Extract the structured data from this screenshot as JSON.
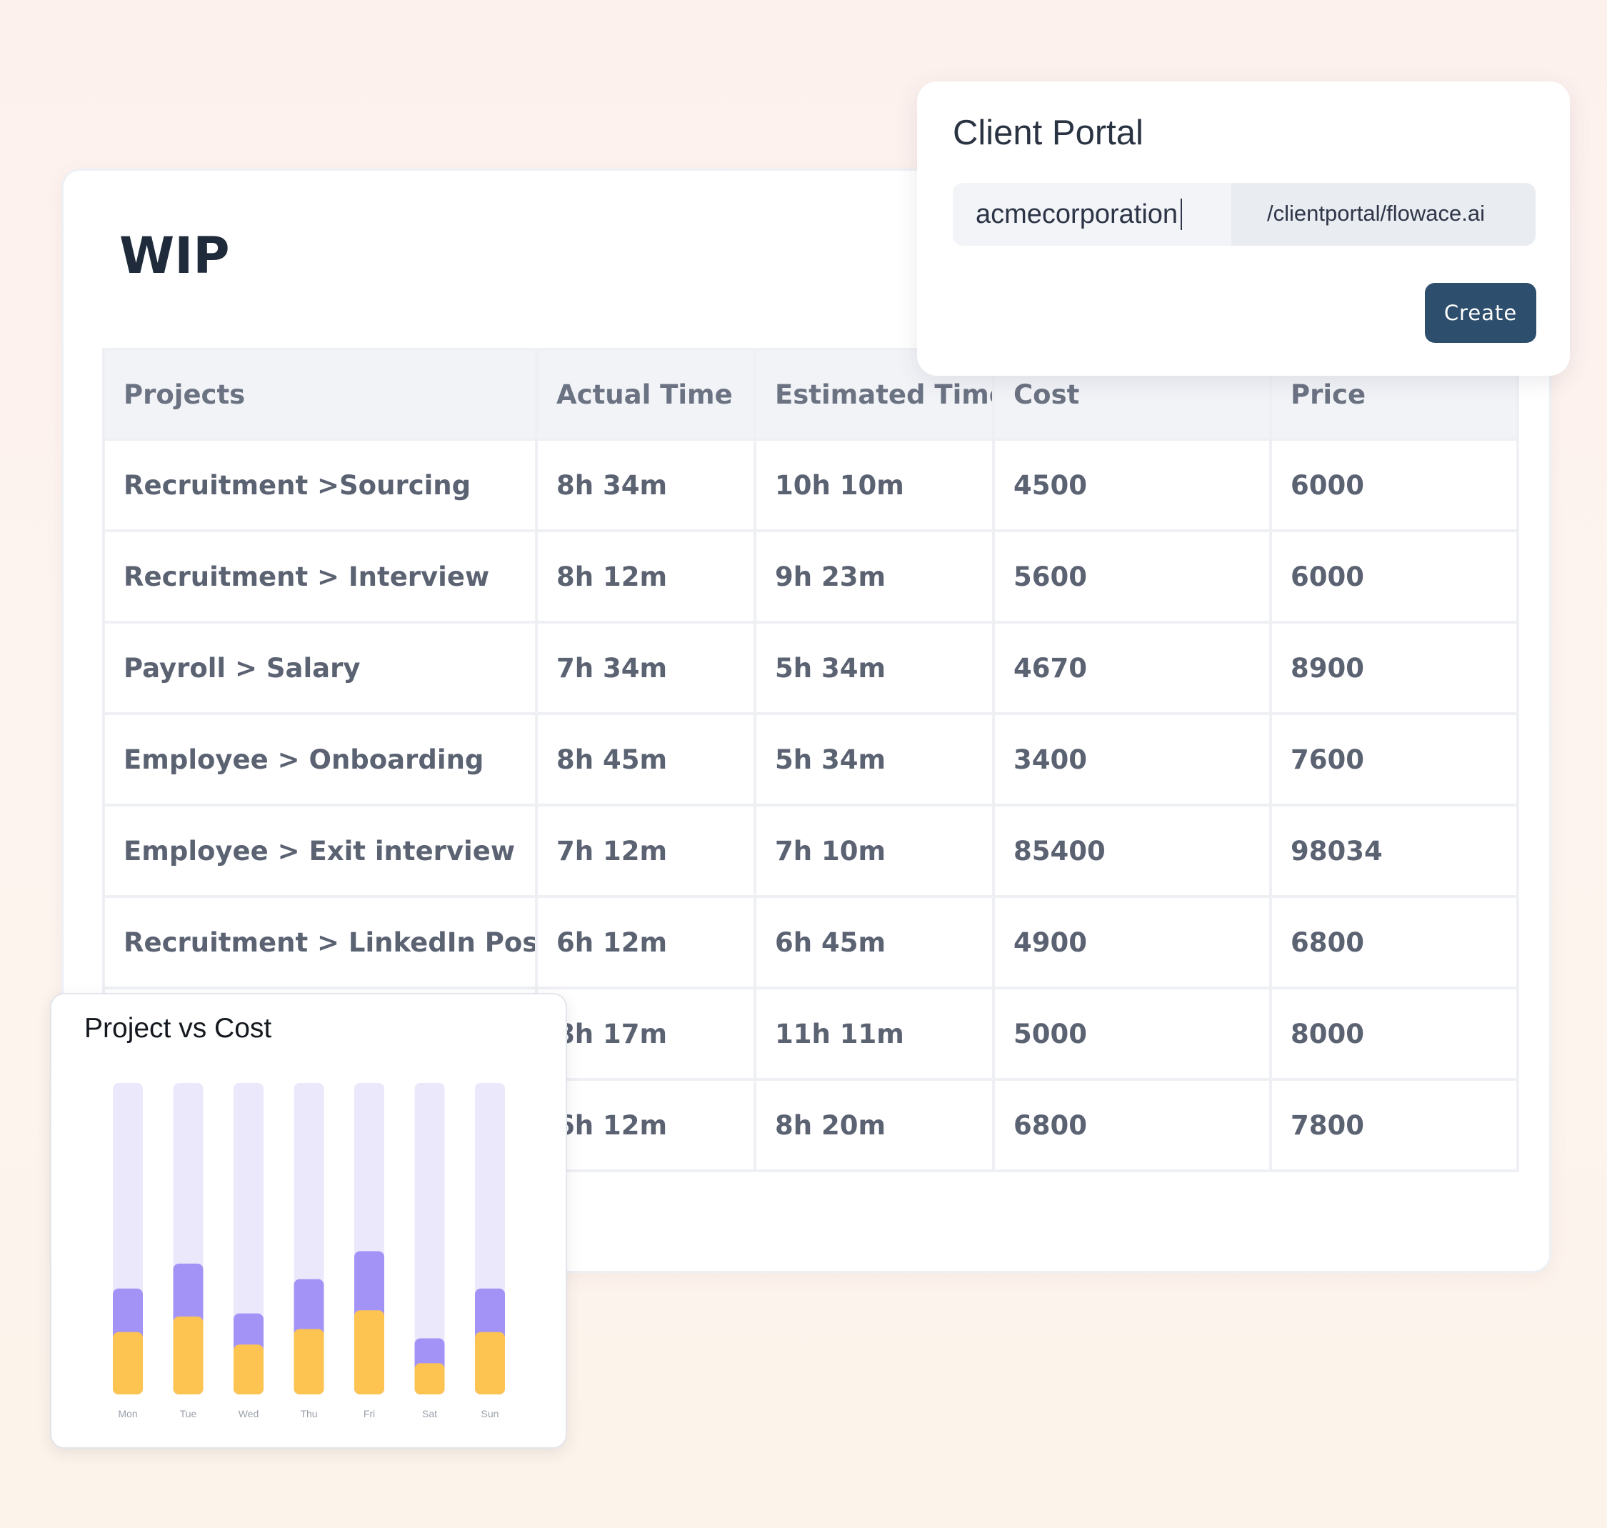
{
  "wip": {
    "title": "WIP",
    "columns": [
      "Projects",
      "Actual Time",
      "Estimated Time",
      "Cost",
      "Price"
    ],
    "rows": [
      [
        "Recruitment >Sourcing",
        "8h 34m",
        "10h 10m",
        "4500",
        "6000"
      ],
      [
        "Recruitment > Interview",
        "8h 12m",
        "9h 23m",
        "5600",
        "6000"
      ],
      [
        "Payroll > Salary",
        "7h 34m",
        "5h 34m",
        "4670",
        "8900"
      ],
      [
        "Employee > Onboarding",
        "8h 45m",
        "5h 34m",
        "3400",
        "7600"
      ],
      [
        "Employee > Exit interview",
        "7h 12m",
        "7h 10m",
        "85400",
        "98034"
      ],
      [
        "Recruitment > LinkedIn Post",
        "6h 12m",
        "6h 45m",
        "4900",
        "6800"
      ],
      [
        "",
        "8h 17m",
        "11h 11m",
        "5000",
        "8000"
      ],
      [
        "",
        "6h 12m",
        "8h 20m",
        "6800",
        "7800"
      ]
    ]
  },
  "client_portal": {
    "title": "Client Portal",
    "input_value": "acmecorporation",
    "url_suffix": "/clientportal/flowace.ai",
    "create_label": "Create"
  },
  "colors": {
    "accent": "#2d4e6c",
    "bar_track": "#ebe8fb",
    "bar_purple": "#a493f6",
    "bar_yellow": "#fdc451"
  },
  "chart_data": {
    "type": "bar",
    "title": "Project vs Cost",
    "categories": [
      "Mon",
      "Tue",
      "Wed",
      "Thu",
      "Fri",
      "Sat",
      "Sun"
    ],
    "series": [
      {
        "values": [
          34,
          42,
          26,
          37,
          46,
          18,
          34
        ]
      },
      {
        "values": [
          20,
          25,
          16,
          21,
          27,
          10,
          20
        ]
      }
    ],
    "ylim": [
      0,
      100
    ]
  }
}
